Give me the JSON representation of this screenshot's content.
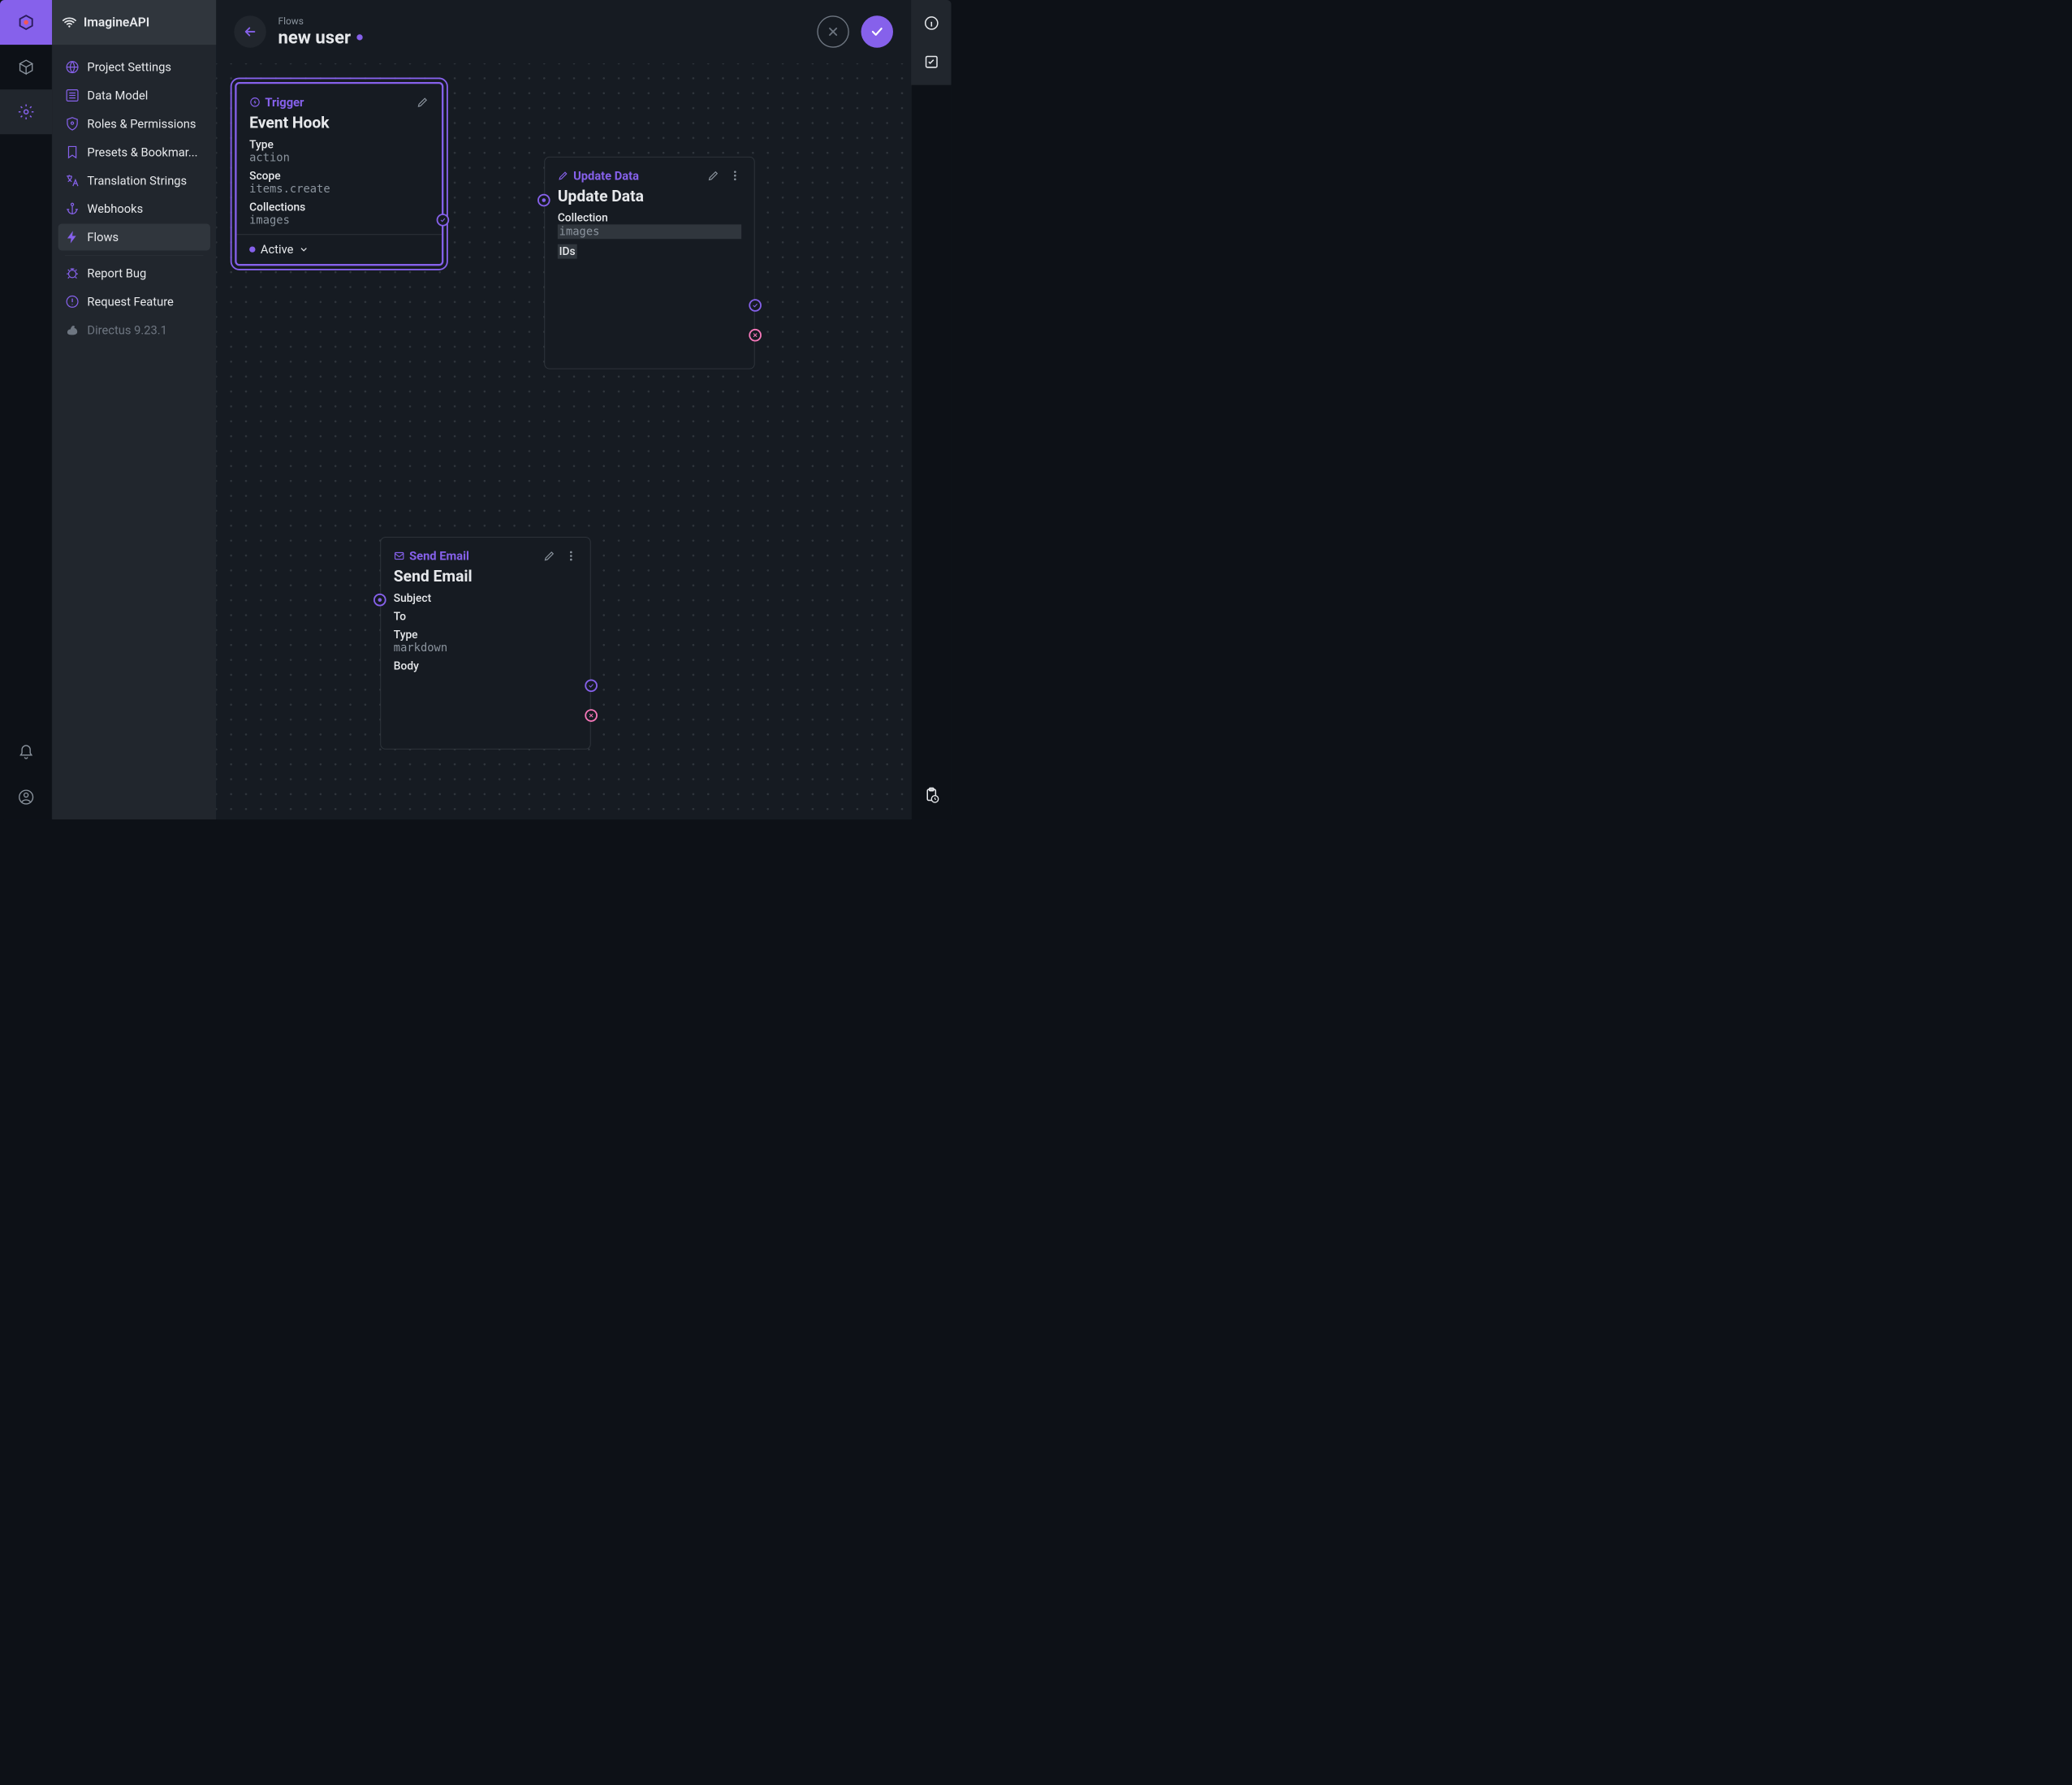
{
  "app": {
    "project_name": "ImagineAPI"
  },
  "sidebar": {
    "items": [
      {
        "label": "Project Settings"
      },
      {
        "label": "Data Model"
      },
      {
        "label": "Roles & Permissions"
      },
      {
        "label": "Presets & Bookmar..."
      },
      {
        "label": "Translation Strings"
      },
      {
        "label": "Webhooks"
      },
      {
        "label": "Flows"
      }
    ],
    "footer": [
      {
        "label": "Report Bug"
      },
      {
        "label": "Request Feature"
      },
      {
        "label": "Directus 9.23.1"
      }
    ]
  },
  "header": {
    "breadcrumb": "Flows",
    "title": "new user"
  },
  "nodes": {
    "trigger": {
      "type_label": "Trigger",
      "title": "Event Hook",
      "fields": [
        {
          "label": "Type",
          "value": "action"
        },
        {
          "label": "Scope",
          "value": "items.create"
        },
        {
          "label": "Collections",
          "value": "images"
        }
      ],
      "status": "Active"
    },
    "update": {
      "type_label": "Update Data",
      "title": "Update Data",
      "fields": [
        {
          "label": "Collection",
          "value": "images",
          "highlight": true
        },
        {
          "label": "IDs",
          "value": "",
          "highlight": true
        }
      ]
    },
    "email": {
      "type_label": "Send Email",
      "title": "Send Email",
      "fields": [
        {
          "label": "Subject",
          "value": ""
        },
        {
          "label": "To",
          "value": ""
        },
        {
          "label": "Type",
          "value": "markdown"
        },
        {
          "label": "Body",
          "value": ""
        }
      ]
    }
  },
  "colors": {
    "accent": "#8661eb",
    "fail": "#f778ba"
  }
}
